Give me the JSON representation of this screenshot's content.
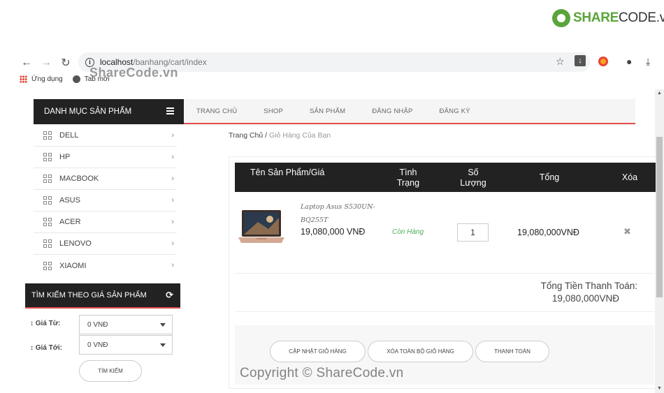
{
  "logo": {
    "part1": "SHARE",
    "part2": "CODE.vn"
  },
  "browser": {
    "url_host": "localhost",
    "url_path": "/banhang/cart/index",
    "bookmarks": [
      {
        "label": "Ứng dụng"
      },
      {
        "label": "Tab mới"
      }
    ]
  },
  "watermarks": {
    "top": "ShareCode.vn",
    "bottom": "Copyright © ShareCode.vn"
  },
  "topnav": {
    "category_header": "DANH MỤC SẢN PHẨM",
    "menu": [
      "TRANG CHỦ",
      "SHOP",
      "SẢN PHẨM",
      "ĐĂNG NHẬP",
      "ĐĂNG KÝ"
    ]
  },
  "categories": [
    "DELL",
    "HP",
    "MACBOOK",
    "ASUS",
    "ACER",
    "LENOVO",
    "XIAOMI"
  ],
  "price_search": {
    "title": "TÌM KIẾM THEO GIÁ SẢN PHẨM",
    "from_label": "Giá Từ:",
    "to_label": "Giá Tới:",
    "from_value": "0 VNĐ",
    "to_value": "0 VNĐ",
    "button": "TÌM KIẾM"
  },
  "breadcrumb": {
    "home": "Trang Chủ",
    "separator": "/",
    "current": "Giỏ Hàng Của Bạn"
  },
  "cart": {
    "headers": {
      "product": "Tên Sản Phẩm/Giá",
      "status_1": "Tình",
      "status_2": "Trạng",
      "qty_1": "Số",
      "qty_2": "Lượng",
      "total": "Tổng",
      "delete": "Xóa"
    },
    "item": {
      "name": "Laptop Asus S530UN-BQ255T",
      "price": "19,080,000 VNĐ",
      "status": "Còn Hàng",
      "quantity": "1",
      "line_total": "19,080,000VNĐ"
    },
    "grand_total_label": "Tổng Tiền Thanh Toán:",
    "grand_total_value": "19,080,000VNĐ",
    "buttons": {
      "update": "CẬP NHẬT GIỎ HÀNG",
      "clear": "XÓA TOÀN BỘ GIỎ HÀNG",
      "checkout": "THANH TOÁN"
    }
  },
  "colors": {
    "accent": "#e14b4b",
    "dark": "#222222",
    "in_stock": "#4caf50",
    "logo_green": "#5aa43b"
  }
}
